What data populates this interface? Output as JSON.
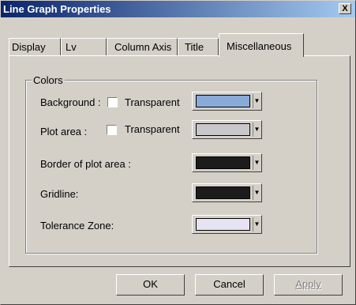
{
  "window": {
    "title": "Line Graph Properties",
    "close_glyph": "X"
  },
  "tabs": [
    {
      "label": "Display",
      "active": false
    },
    {
      "label": "Lv",
      "active": false
    },
    {
      "label": "Column Axis",
      "active": false
    },
    {
      "label": "Title",
      "active": false
    },
    {
      "label": "Miscellaneous",
      "active": true
    }
  ],
  "colors_group": {
    "label": "Colors",
    "rows": [
      {
        "label": "Background :",
        "has_transparent": true,
        "transparent_label": "Transparent",
        "transparent_checked": false,
        "color": "#8aaad8"
      },
      {
        "label": "Plot area :",
        "has_transparent": true,
        "transparent_label": "Transparent",
        "transparent_checked": false,
        "color": "#c8c8cc"
      },
      {
        "label": "Border of plot area :",
        "has_transparent": false,
        "color": "#1c1c1c"
      },
      {
        "label": "Gridline:",
        "has_transparent": false,
        "color": "#1c1c1c"
      },
      {
        "label": "Tolerance Zone:",
        "has_transparent": false,
        "color": "#e6e4f2"
      }
    ],
    "dropdown_icon": "triangle-down-icon"
  },
  "buttons": {
    "ok": "OK",
    "cancel": "Cancel",
    "apply": "Apply"
  },
  "theme": {
    "titlebar_start": "#0a246a",
    "titlebar_end": "#a6caf0",
    "face": "#d4d0c8"
  }
}
